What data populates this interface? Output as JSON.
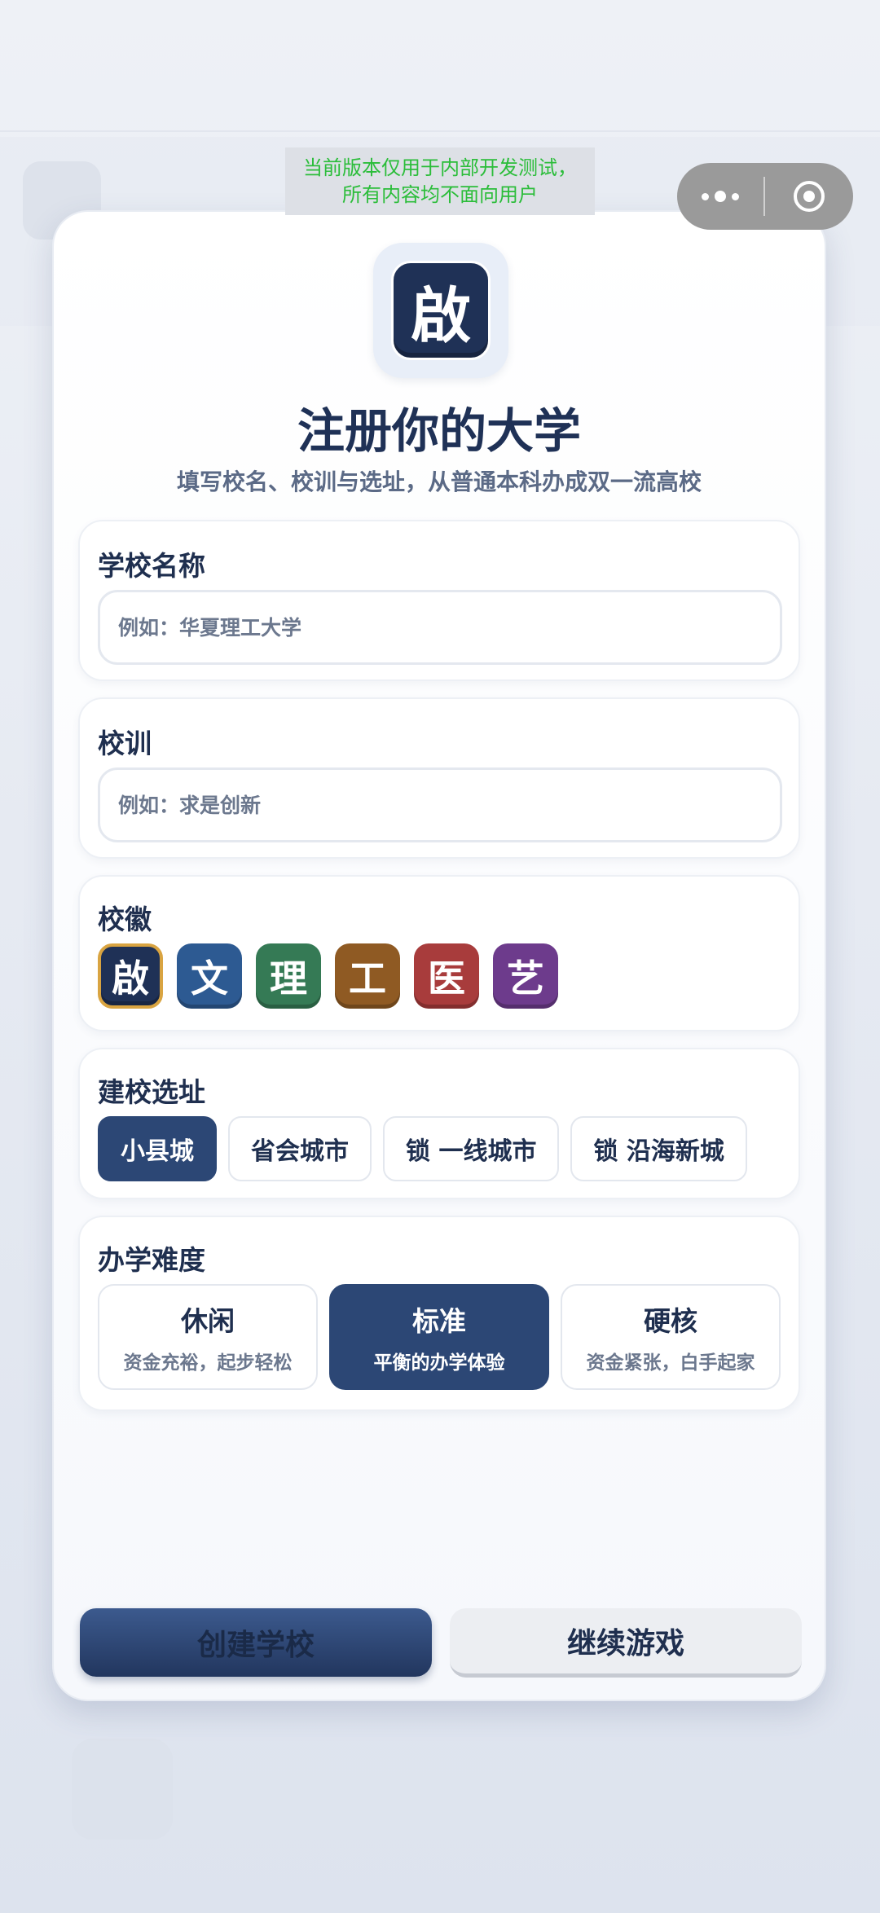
{
  "dev_banner": {
    "line1": "当前版本仅用于内部开发测试，",
    "line2": "所有内容均不面向用户"
  },
  "capsule": {
    "more_icon": "more-dots-icon",
    "close_icon": "target-circle-icon"
  },
  "header": {
    "logo_char": "啟",
    "title": "注册你的大学",
    "subtitle": "填写校名、校训与选址，从普通本科办成双一流高校"
  },
  "school_name": {
    "label": "学校名称",
    "placeholder": "例如：华夏理工大学",
    "value": ""
  },
  "motto": {
    "label": "校训",
    "placeholder": "例如：求是创新",
    "value": ""
  },
  "emblem": {
    "label": "校徽",
    "options": [
      {
        "char": "啟",
        "color": "#1f3156",
        "selected": true
      },
      {
        "char": "文",
        "color": "#2d5a92",
        "selected": false
      },
      {
        "char": "理",
        "color": "#357a55",
        "selected": false
      },
      {
        "char": "工",
        "color": "#8f5a23",
        "selected": false
      },
      {
        "char": "医",
        "color": "#a83c3c",
        "selected": false
      },
      {
        "char": "艺",
        "color": "#6d3b8c",
        "selected": false
      }
    ]
  },
  "location": {
    "label": "建校选址",
    "options": [
      {
        "label": "小县城",
        "active": true
      },
      {
        "label": "省会城市",
        "active": false
      },
      {
        "label": "锁 一线城市",
        "active": false
      },
      {
        "label": "锁 沿海新城",
        "active": false
      }
    ]
  },
  "difficulty": {
    "label": "办学难度",
    "options": [
      {
        "name": "休闲",
        "desc": "资金充裕，起步轻松",
        "active": false
      },
      {
        "name": "标准",
        "desc": "平衡的办学体验",
        "active": true
      },
      {
        "name": "硬核",
        "desc": "资金紧张，白手起家",
        "active": false
      }
    ]
  },
  "actions": {
    "create_label": "创建学校",
    "continue_label": "继续游戏"
  }
}
